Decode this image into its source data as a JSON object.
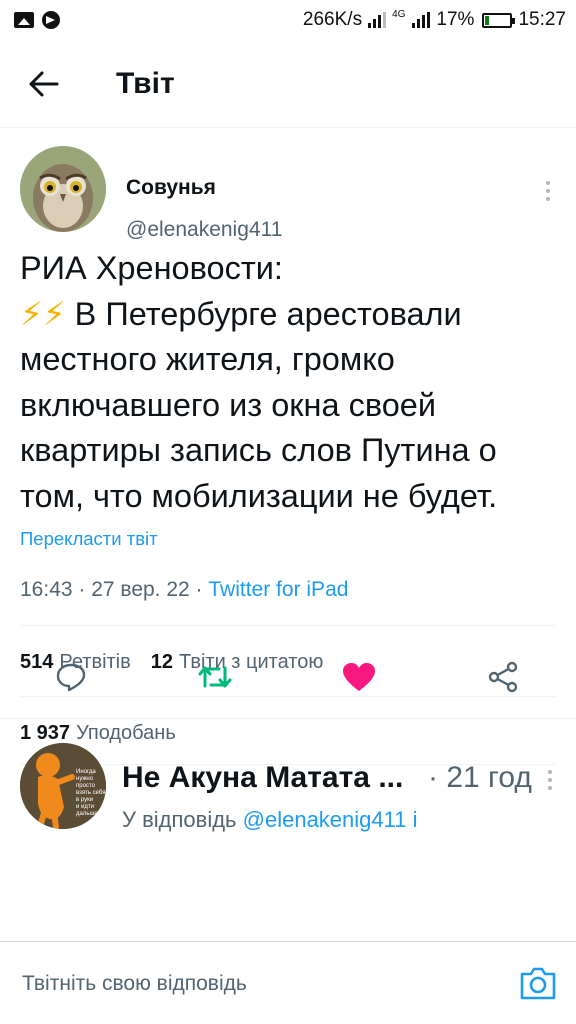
{
  "status_bar": {
    "speed": "266K/s",
    "network": "4G",
    "battery_percent": "17%",
    "battery_level": 0.17,
    "time": "15:27"
  },
  "header": {
    "title": "Твіт",
    "back_icon": "arrow-left-icon"
  },
  "tweet": {
    "author_name": "Совунья",
    "author_handle": "@elenakenig411",
    "text_line1": "РИА Хреновости:",
    "emoji": "⚡⚡",
    "text_rest": " В Петербурге арестовали местного жителя, громко включавшего из окна своей квартиры запись слов Путина о том, что мобилизации не будет.",
    "translate_label": "Перекласти твіт",
    "time_date": "16:43 · 27 вер. 22 · ",
    "source": "Twitter for iPad",
    "retweets_count": "514",
    "retweets_label": "Ретвітів",
    "quotes_count": "12",
    "quotes_label": "Твіти з цитатою",
    "likes_count": "1 937",
    "likes_label": "Уподобань"
  },
  "actions": {
    "reply_icon": "reply-icon",
    "retweet_icon": "retweet-icon",
    "like_icon": "heart-icon",
    "share_icon": "share-icon",
    "colors": {
      "retweet": "#00ba7c",
      "like": "#f91880",
      "neutral": "#536471"
    }
  },
  "reply": {
    "author_name": "Не Акуна Матата ...",
    "time": "· 21 год",
    "replying_prefix": "У відповідь ",
    "replying_mention": "@elenakenig411 і",
    "avatar_caption": "Иногда нужно просто взять себя в руки и идти дальше"
  },
  "compose": {
    "placeholder": "Твітніть свою відповідь",
    "camera_icon": "camera-icon"
  }
}
